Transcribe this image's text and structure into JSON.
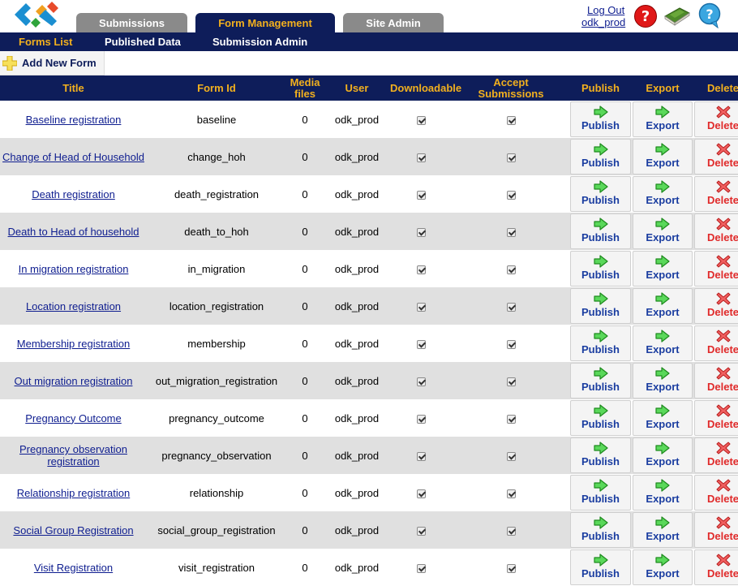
{
  "header": {
    "tabs": [
      {
        "label": "Submissions"
      },
      {
        "label": "Form Management"
      },
      {
        "label": "Site Admin"
      }
    ],
    "logout_label": "Log Out",
    "username": "odk_prod"
  },
  "subnav": {
    "items": [
      {
        "label": "Forms List"
      },
      {
        "label": "Published Data"
      },
      {
        "label": "Submission Admin"
      }
    ]
  },
  "toolbar": {
    "add_form_label": "Add New Form"
  },
  "table": {
    "columns": [
      "Title",
      "Form Id",
      "Media files",
      "User",
      "Downloadable",
      "Accept Submissions",
      "Publish",
      "Export",
      "Delete"
    ],
    "action_labels": {
      "publish": "Publish",
      "export": "Export",
      "delete": "Delete"
    },
    "rows": [
      {
        "title": "Baseline registration",
        "form_id": "baseline",
        "media": "0",
        "user": "odk_prod",
        "downloadable": true,
        "accept": true
      },
      {
        "title": "Change of Head of Household",
        "form_id": "change_hoh",
        "media": "0",
        "user": "odk_prod",
        "downloadable": true,
        "accept": true
      },
      {
        "title": "Death registration",
        "form_id": "death_registration",
        "media": "0",
        "user": "odk_prod",
        "downloadable": true,
        "accept": true
      },
      {
        "title": "Death to Head of household",
        "form_id": "death_to_hoh",
        "media": "0",
        "user": "odk_prod",
        "downloadable": true,
        "accept": true
      },
      {
        "title": "In migration registration",
        "form_id": "in_migration",
        "media": "0",
        "user": "odk_prod",
        "downloadable": true,
        "accept": true
      },
      {
        "title": "Location registration",
        "form_id": "location_registration",
        "media": "0",
        "user": "odk_prod",
        "downloadable": true,
        "accept": true
      },
      {
        "title": "Membership registration",
        "form_id": "membership",
        "media": "0",
        "user": "odk_prod",
        "downloadable": true,
        "accept": true
      },
      {
        "title": "Out migration registration",
        "form_id": "out_migration_registration",
        "media": "0",
        "user": "odk_prod",
        "downloadable": true,
        "accept": true
      },
      {
        "title": "Pregnancy Outcome",
        "form_id": "pregnancy_outcome",
        "media": "0",
        "user": "odk_prod",
        "downloadable": true,
        "accept": true
      },
      {
        "title": "Pregnancy observation registration",
        "form_id": "pregnancy_observation",
        "media": "0",
        "user": "odk_prod",
        "downloadable": true,
        "accept": true
      },
      {
        "title": "Relationship registration",
        "form_id": "relationship",
        "media": "0",
        "user": "odk_prod",
        "downloadable": true,
        "accept": true
      },
      {
        "title": "Social Group Registration",
        "form_id": "social_group_registration",
        "media": "0",
        "user": "odk_prod",
        "downloadable": true,
        "accept": true
      },
      {
        "title": "Visit Registration",
        "form_id": "visit_registration",
        "media": "0",
        "user": "odk_prod",
        "downloadable": true,
        "accept": true
      }
    ]
  },
  "icons": {
    "logo": "odk-logo-icon",
    "help": "help-icon",
    "guide": "user-guide-book-icon",
    "info": "info-bubble-icon",
    "add": "plus-icon",
    "publish": "green-arrow-right-icon",
    "export": "green-arrow-right-icon",
    "delete": "red-x-icon"
  },
  "colors": {
    "nav_bg": "#0e1d5a",
    "nav_accent": "#f2b01e",
    "tab_inactive": "#8a8a8a",
    "row_alt": "#e0e0e0",
    "link": "#0e1d8f",
    "delete_red": "#e02a2a"
  }
}
